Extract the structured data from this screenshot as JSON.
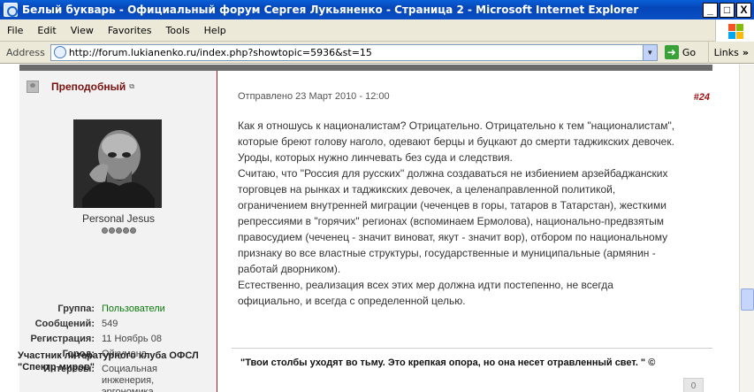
{
  "window": {
    "title": "Белый букварь - Официальный форум Сергея Лукьяненко - Страница 2 - Microsoft Internet Explorer",
    "controls": {
      "minimize": "_",
      "maximize": "□",
      "close": "X"
    }
  },
  "menu": {
    "items": [
      "File",
      "Edit",
      "View",
      "Favorites",
      "Tools",
      "Help"
    ]
  },
  "addressbar": {
    "label": "Address",
    "url": "http://forum.lukianenko.ru/index.php?showtopic=5936&st=15",
    "go_label": "Go",
    "links_label": "Links",
    "links_chevron": "»"
  },
  "post": {
    "author": {
      "name": "Преподобный",
      "member_title": "Personal Jesus",
      "rating_pips": 5,
      "fields": [
        {
          "label": "Группа:",
          "value": "Пользователи"
        },
        {
          "label": "Сообщений:",
          "value": "549"
        },
        {
          "label": "Регистрация:",
          "value": "11 Ноябрь 08"
        },
        {
          "label": "Город:",
          "value": "Ойкумена"
        },
        {
          "label": "Интересы:",
          "value": "Социальная инженерия, эргономика, коммерция."
        }
      ],
      "signature_badge": "Участник литературного клуба ОФСЛ \"Спектр миров\""
    },
    "date": "Отправлено 23 Март 2010 - 12:00",
    "number": "#24",
    "body_lines": [
      "Как я отношусь к националистам? Отрицательно. Отрицательно к тем \"националистам\",",
      "которые бреют голову наголо, одевают берцы и буцкают до смерти таджикских девочек.",
      "Уроды, которых нужно линчевать без суда и следствия.",
      "Считаю, что \"Россия для русских\" должна создаваться не избиением арзейбаджанских",
      "торговцев на рынках и таджикских девочек, а целенаправленной политикой,",
      "ограничением внутренней миграции (чеченцев в горы, татаров в Татарстан), жесткими",
      "репрессиями в \"горячих\" регионах (вспоминаем Ермолова), национально-предвзятым",
      "правосудием (чеченец - значит виноват, якут - значит вор), отбором по национальному",
      "признаку во все властные структуры, государственные и муниципальные (армянин -",
      "работай дворником).",
      "Естественно, реализация всех этих мер должна идти постепенно, не всегда",
      "официально, и всегда с определенной целью."
    ],
    "signature_quote": "\"Твои столбы уходят во тьму. Это крепкая опора, но она несет отравленный свет. \" ©",
    "reply_count": "0"
  }
}
